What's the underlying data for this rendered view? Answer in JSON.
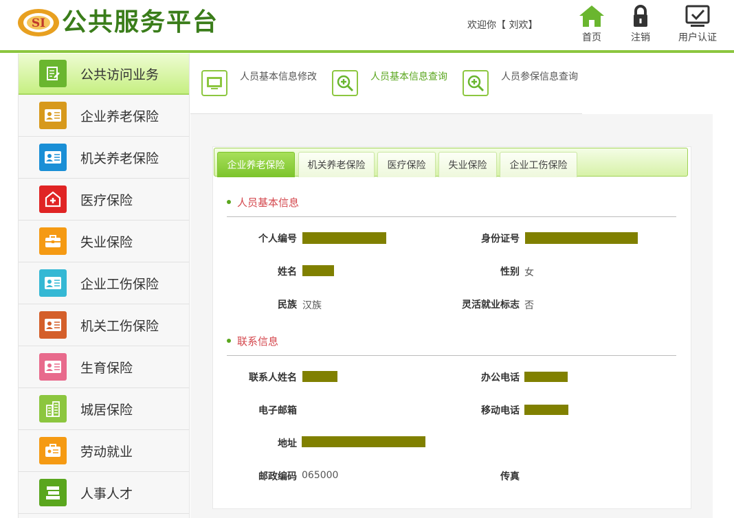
{
  "header": {
    "title": "公共服务平台",
    "logo_text": "SI",
    "welcome": "欢迎你【 刘欢】",
    "nav": [
      {
        "label": "首页",
        "icon": "home-icon"
      },
      {
        "label": "注销",
        "icon": "lock-icon"
      },
      {
        "label": "用户认证",
        "icon": "monitor-check-icon"
      }
    ]
  },
  "colors": {
    "accent": "#8cc63f",
    "brand": "#3a7d1a",
    "section_title": "#d4484e",
    "redaction": "#808000"
  },
  "sidebar": {
    "items": [
      {
        "label": "公共访问业务",
        "icon": "document-edit-icon",
        "color": "#6ab62f",
        "active": true
      },
      {
        "label": "企业养老保险",
        "icon": "id-card-icon",
        "color": "#d7991c"
      },
      {
        "label": "机关养老保险",
        "icon": "id-card-icon",
        "color": "#1a8fd6"
      },
      {
        "label": "医疗保险",
        "icon": "hospital-icon",
        "color": "#e02424"
      },
      {
        "label": "失业保险",
        "icon": "briefcase-icon",
        "color": "#f59a13"
      },
      {
        "label": "企业工伤保险",
        "icon": "id-card-icon",
        "color": "#35b8d4"
      },
      {
        "label": "机关工伤保险",
        "icon": "id-card-icon",
        "color": "#d45f2a"
      },
      {
        "label": "生育保险",
        "icon": "id-card-icon",
        "color": "#e86a8c"
      },
      {
        "label": "城居保险",
        "icon": "buildings-icon",
        "color": "#8cc63f"
      },
      {
        "label": "劳动就业",
        "icon": "briefcase-card-icon",
        "color": "#f59a13"
      },
      {
        "label": "人事人才",
        "icon": "books-icon",
        "color": "#5aa61e"
      }
    ]
  },
  "functions": [
    {
      "label": "人员基本信息修改",
      "icon": "monitor-icon"
    },
    {
      "label": "人员基本信息查询",
      "icon": "zoom-in-icon",
      "active": true
    },
    {
      "label": "人员参保信息查询",
      "icon": "zoom-in-icon"
    }
  ],
  "tabs": [
    {
      "label": "企业养老保险",
      "active": true
    },
    {
      "label": "机关养老保险"
    },
    {
      "label": "医疗保险"
    },
    {
      "label": "失业保险"
    },
    {
      "label": "企业工伤保险"
    }
  ],
  "basic_info": {
    "title": "人员基本信息",
    "id_label": "个人编号",
    "idcard_label": "身份证号",
    "name_label": "姓名",
    "gender_label": "性别",
    "gender_value": "女",
    "ethnicity_label": "民族",
    "ethnicity_value": "汉族",
    "flex_label": "灵活就业标志",
    "flex_value": "否"
  },
  "contact_info": {
    "title": "联系信息",
    "contact_name_label": "联系人姓名",
    "office_phone_label": "办公电话",
    "email_label": "电子邮箱",
    "mobile_label": "移动电话",
    "address_label": "地址",
    "postcode_label": "邮政编码",
    "postcode_value": "065000",
    "fax_label": "传真"
  }
}
